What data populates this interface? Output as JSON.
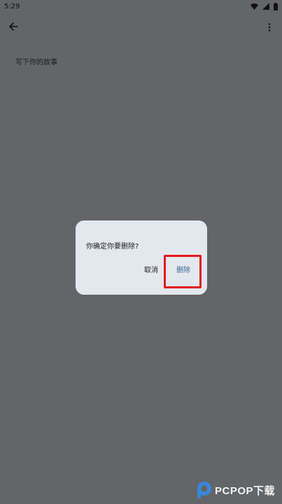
{
  "status_bar": {
    "time": "5:29",
    "icons": [
      "wifi-icon",
      "signal-icon",
      "battery-icon"
    ]
  },
  "app_bar": {
    "back_icon": "arrow-left-icon",
    "more_icon": "more-vertical-icon"
  },
  "editor": {
    "placeholder": "写下你的故事"
  },
  "dialog": {
    "message": "你确定你要删除?",
    "cancel_label": "取消",
    "delete_label": "删除"
  },
  "watermark": {
    "text": "PCPOP下载"
  },
  "colors": {
    "scrim_background": "#636568",
    "dialog_background": "#e3e7ee",
    "delete_accent": "#3a6b93",
    "highlight_red": "#e31818"
  }
}
